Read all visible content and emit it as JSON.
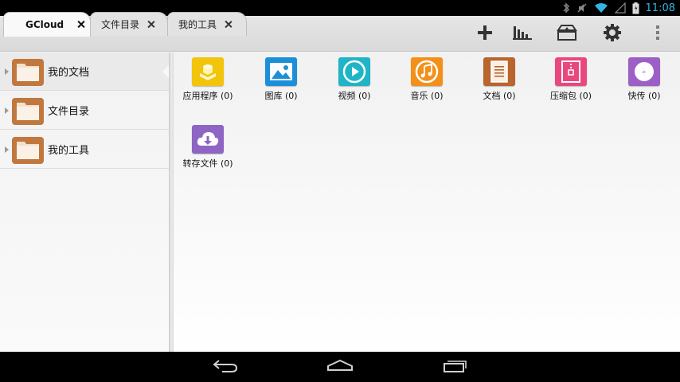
{
  "status_bar": {
    "time": "11:08",
    "icons": [
      "bluetooth-icon",
      "mute-icon",
      "wifi-icon",
      "signal-icon",
      "battery-icon"
    ],
    "accent_color": "#33b5e5"
  },
  "tabs": [
    {
      "label": "GCloud",
      "active": true
    },
    {
      "label": "文件目录",
      "active": false
    },
    {
      "label": "我的工具",
      "active": false
    }
  ],
  "toolbar": [
    "add-icon",
    "bar-chart-icon",
    "transfer-box-icon",
    "gear-icon",
    "overflow-menu-icon"
  ],
  "sidebar": {
    "items": [
      {
        "label": "我的文档",
        "selected": true
      },
      {
        "label": "文件目录",
        "selected": false
      },
      {
        "label": "我的工具",
        "selected": false
      }
    ]
  },
  "categories": [
    {
      "label": "应用程序 (0)",
      "icon": "apps-icon",
      "color": "#f2c40c"
    },
    {
      "label": "图库 (0)",
      "icon": "gallery-icon",
      "color": "#1c8fd8"
    },
    {
      "label": "视频 (0)",
      "icon": "video-icon",
      "color": "#1fb4c6"
    },
    {
      "label": "音乐 (0)",
      "icon": "music-icon",
      "color": "#f39019"
    },
    {
      "label": "文档 (0)",
      "icon": "document-icon",
      "color": "#b8652e"
    },
    {
      "label": "压缩包 (0)",
      "icon": "archive-icon",
      "color": "#e9487f"
    },
    {
      "label": "快传 (0)",
      "icon": "quick-transfer-icon",
      "color": "#9c5fc6"
    },
    {
      "label": "转存文件 (0)",
      "icon": "cloud-download-icon",
      "color": "#8e64c4"
    }
  ],
  "nav_bar": [
    "back-icon",
    "home-icon",
    "recent-apps-icon"
  ]
}
